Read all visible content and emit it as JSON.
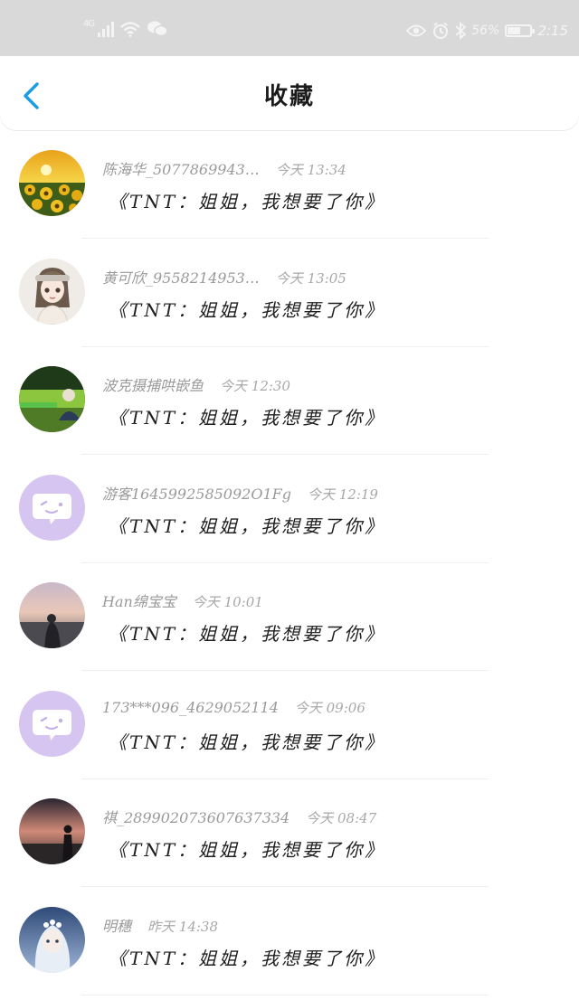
{
  "status_bar": {
    "network": "4G",
    "battery_percent": "56%",
    "battery_level": 0.56,
    "time": "2:15",
    "icons": [
      "signal-icon",
      "wifi-icon",
      "wechat-icon",
      "eye-icon",
      "alarm-icon",
      "bluetooth-icon",
      "battery-icon"
    ]
  },
  "header": {
    "title": "收藏",
    "back_icon": "chevron-left-icon",
    "accent_color": "#1a9be6"
  },
  "items": [
    {
      "name": "陈海华_5077869943…",
      "time": "今天 13:34",
      "content": "《TNT：姐姐，我想要了你》",
      "avatar": "sunflower"
    },
    {
      "name": "黄可欣_9558214953…",
      "time": "今天 13:05",
      "content": "《TNT：姐姐，我想要了你》",
      "avatar": "cartoon-girl"
    },
    {
      "name": "波克摄捕哄嵌鱼",
      "time": "今天 12:30",
      "content": "《TNT：姐姐，我想要了你》",
      "avatar": "field-photo"
    },
    {
      "name": "游客1645992585092O1Fg",
      "time": "今天 12:19",
      "content": "《TNT：姐姐，我想要了你》",
      "avatar": "default-purple"
    },
    {
      "name": "Han绵宝宝",
      "time": "今天 10:01",
      "content": "《TNT：姐姐，我想要了你》",
      "avatar": "sunset-figure"
    },
    {
      "name": "173***096_4629052114",
      "time": "今天 09:06",
      "content": "《TNT：姐姐，我想要了你》",
      "avatar": "default-purple"
    },
    {
      "name": "祺_289902073607637334",
      "time": "今天 08:47",
      "content": "《TNT：姐姐，我想要了你》",
      "avatar": "dusk-figure"
    },
    {
      "name": "明穗",
      "time": "昨天 14:38",
      "content": "《TNT：姐姐，我想要了你》",
      "avatar": "anime-girl"
    }
  ]
}
